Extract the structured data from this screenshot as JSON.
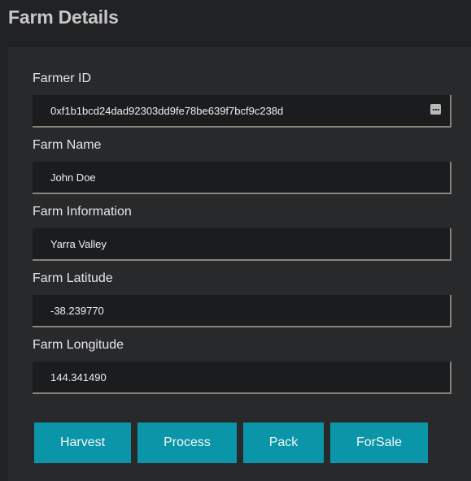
{
  "page": {
    "title": "Farm Details"
  },
  "fields": [
    {
      "label": "Farmer ID",
      "value": "0xf1b1bcd24dad92303dd9fe78be639f7bcf9c238d"
    },
    {
      "label": "Farm Name",
      "value": "John Doe"
    },
    {
      "label": "Farm Information",
      "value": "Yarra Valley"
    },
    {
      "label": "Farm Latitude",
      "value": "-38.239770"
    },
    {
      "label": "Farm Longitude",
      "value": "144.341490"
    }
  ],
  "field_icons": {
    "farmer_id": "more-options-icon"
  },
  "actions": [
    {
      "label": "Harvest"
    },
    {
      "label": "Process"
    },
    {
      "label": "Pack"
    },
    {
      "label": "ForSale"
    }
  ],
  "colors": {
    "background": "#212224",
    "panel": "#28292b",
    "input": "#1b1c1e",
    "input_border": "#8a847c",
    "button": "#0a95a8",
    "title": "#c7c7c7"
  }
}
